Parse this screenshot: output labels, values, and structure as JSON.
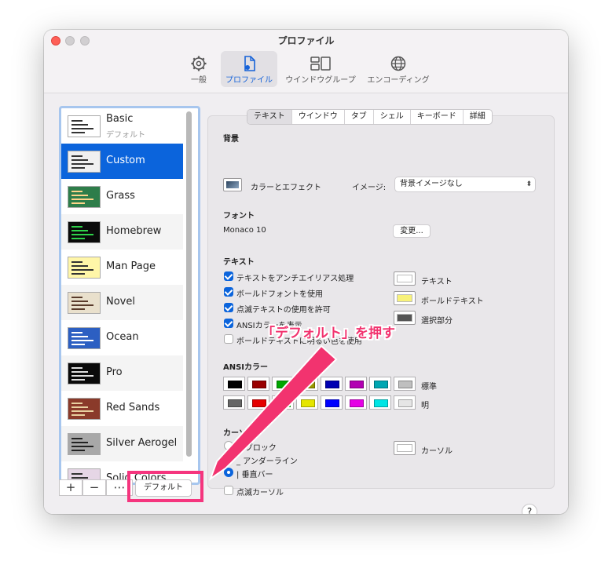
{
  "window": {
    "title": "プロファイル",
    "toolbar": [
      {
        "label": "一般",
        "icon": "gear-icon"
      },
      {
        "label": "プロファイル",
        "icon": "profile-document-icon",
        "active": true
      },
      {
        "label": "ウインドウグループ",
        "icon": "window-group-icon"
      },
      {
        "label": "エンコーディング",
        "icon": "globe-icon"
      }
    ]
  },
  "profiles": [
    {
      "name": "Basic",
      "sub": "デフォルト",
      "thumb": "#ffffff",
      "fg": "#333333"
    },
    {
      "name": "Custom",
      "thumb": "#f0f0f0",
      "fg": "#333333",
      "selected": true
    },
    {
      "name": "Grass",
      "thumb": "#2e7d4a",
      "fg": "#ffd48a"
    },
    {
      "name": "Homebrew",
      "thumb": "#0a0a0a",
      "fg": "#2fd14a"
    },
    {
      "name": "Man Page",
      "thumb": "#fff6a8",
      "fg": "#333333"
    },
    {
      "name": "Novel",
      "thumb": "#e9e0cc",
      "fg": "#5a3b2b"
    },
    {
      "name": "Ocean",
      "thumb": "#2c5fc2",
      "fg": "#ffffff"
    },
    {
      "name": "Pro",
      "thumb": "#0a0a0a",
      "fg": "#dddddd"
    },
    {
      "name": "Red Sands",
      "thumb": "#8a3a2a",
      "fg": "#e8d0a0"
    },
    {
      "name": "Silver Aerogel",
      "thumb": "#a8a8a8",
      "fg": "#222222"
    },
    {
      "name": "Solid Colors",
      "thumb": "#e6d6e6",
      "fg": "#333333"
    }
  ],
  "list_buttons": {
    "add": "+",
    "remove": "−",
    "more": "⋯",
    "default": "デフォルト"
  },
  "tabs": [
    "テキスト",
    "ウインドウ",
    "タブ",
    "シェル",
    "キーボード",
    "詳細"
  ],
  "active_tab": "テキスト",
  "background": {
    "heading": "背景",
    "color_effect": "カラーとエフェクト",
    "image_label": "イメージ:",
    "image_value": "背景イメージなし"
  },
  "font": {
    "heading": "フォント",
    "value": "Monaco 10",
    "change": "変更..."
  },
  "text": {
    "heading": "テキスト",
    "options": [
      {
        "label": "テキストをアンチエイリアス処理",
        "checked": true
      },
      {
        "label": "ボールドフォントを使用",
        "checked": true
      },
      {
        "label": "点滅テキストの使用を許可",
        "checked": true
      },
      {
        "label": "ANSIカラーを表示",
        "checked": true
      },
      {
        "label": "ボールドテキストに明るい色を使用",
        "checked": false
      }
    ],
    "colors": [
      {
        "label": "テキスト",
        "color": "#ffffff"
      },
      {
        "label": "ボールドテキスト",
        "color": "#f8f27a"
      },
      {
        "label": "選択部分",
        "color": "#555555"
      }
    ]
  },
  "ansi": {
    "heading": "ANSIカラー",
    "normal_label": "標準",
    "bright_label": "明",
    "normal": [
      "#000000",
      "#990000",
      "#00a600",
      "#999900",
      "#0000b2",
      "#b200b2",
      "#00a6b2",
      "#bfbfbf"
    ],
    "bright": [
      "#666666",
      "#e50000",
      "#00d900",
      "#e5e500",
      "#0000ff",
      "#e500e5",
      "#00e5e5",
      "#e5e5e5"
    ]
  },
  "cursor": {
    "heading": "カーソル",
    "options": [
      {
        "label": "ブロック",
        "selected": false
      },
      {
        "label": "アンダーライン",
        "selected": false
      },
      {
        "label": "垂直バー",
        "selected": true
      }
    ],
    "blink": "点滅カーソル",
    "color_label": "カーソル"
  },
  "help": "?",
  "annotation": "「デフォルト」を押す",
  "colors": {
    "accent": "#0b64dc",
    "annotation": "#f2336f"
  }
}
